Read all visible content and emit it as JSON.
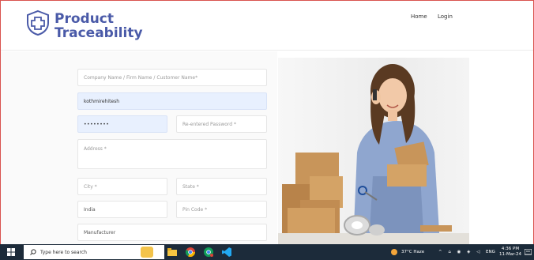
{
  "brand": {
    "line1": "Product",
    "line2": "Traceability",
    "color": "#4a5aa8"
  },
  "nav": {
    "home": "Home",
    "login": "Login"
  },
  "form": {
    "company_placeholder": "Company Name / Firm Name / Customer Name*",
    "username_value": "kothmirehitesh",
    "password_value": "••••••••",
    "reenter_placeholder": "Re-entered Password *",
    "address_placeholder": "Address *",
    "city_placeholder": "City *",
    "state_placeholder": "State *",
    "country_value": "India",
    "pincode_placeholder": "Pin Code *",
    "role_value": "Manufacturer"
  },
  "taskbar": {
    "search_placeholder": "Type here to search",
    "weather": "37°C  Haze",
    "lang": "ENG",
    "time": "4:36 PM",
    "date": "11-Mar-24"
  }
}
